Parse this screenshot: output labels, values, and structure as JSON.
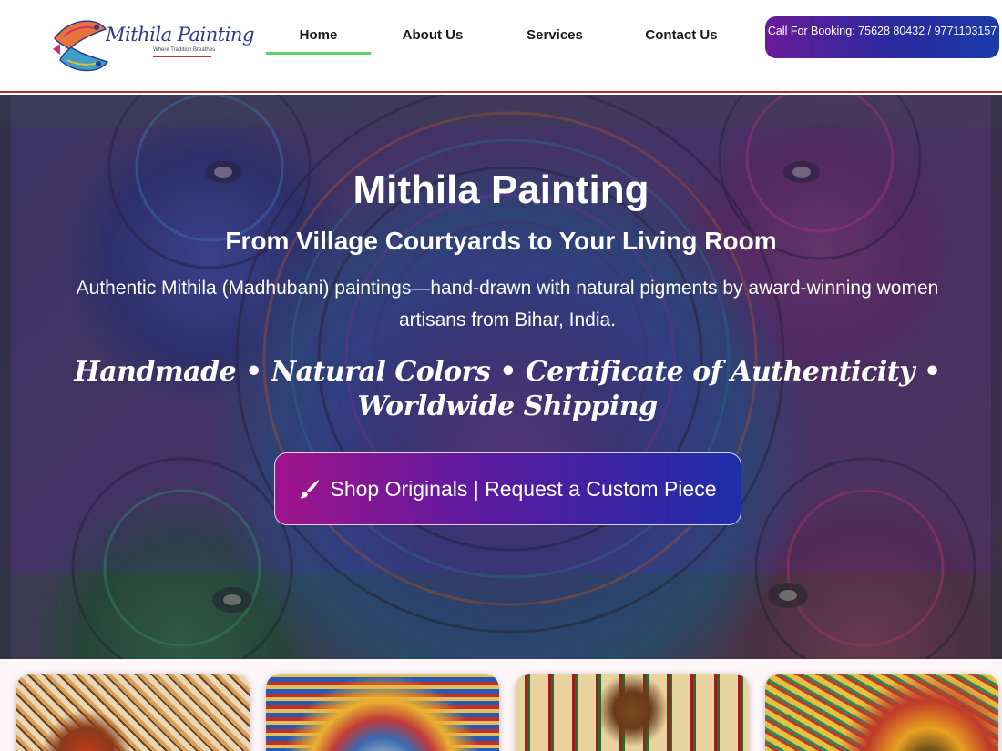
{
  "brand": {
    "name": "Mithila Painting",
    "tagline": "Where Tradition Breathes"
  },
  "nav": {
    "items": [
      {
        "label": "Home",
        "active": true
      },
      {
        "label": "About Us"
      },
      {
        "label": "Services"
      },
      {
        "label": "Contact Us"
      }
    ],
    "call_button": "Call For Booking: 75628 80432 / 9771103157"
  },
  "hero": {
    "title": "Mithila Painting",
    "subtitle": "From Village Courtyards to Your Living Room",
    "description": "Authentic Mithila (Madhubani) paintings—hand-drawn with natural pigments by award-winning women artisans from Bihar, India.",
    "features": "Handmade • Natural Colors • Certificate of Authenticity • Worldwide Shipping",
    "cta_label": "Shop Originals | Request a Custom Piece",
    "cta_icon": "paintbrush-icon"
  },
  "colors": {
    "nav_active_underline": "#61ce70",
    "header_border": "#b32b2b",
    "button_gradient_start": "#a0148c",
    "button_gradient_end": "#1e2ea8"
  },
  "gallery": {
    "cards": [
      {
        "name": "painting-card-1"
      },
      {
        "name": "painting-card-2"
      },
      {
        "name": "painting-card-3"
      },
      {
        "name": "painting-card-4"
      }
    ]
  }
}
